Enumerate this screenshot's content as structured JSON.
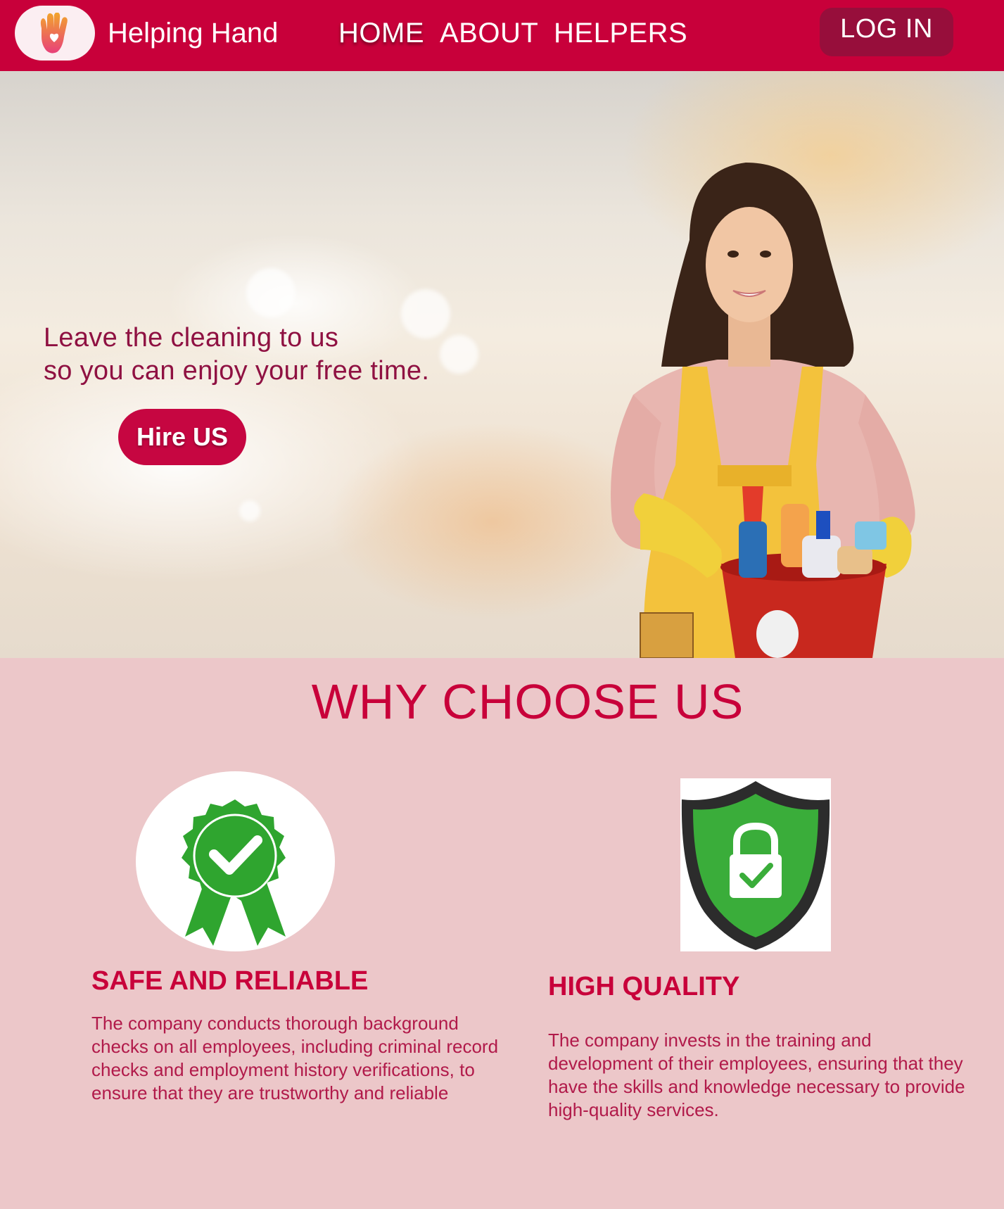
{
  "nav": {
    "brand": "Helping Hand",
    "links": [
      "HOME",
      "ABOUT",
      "HELPERS"
    ],
    "login": "LOG IN",
    "logo_icon": "hand-heart-icon"
  },
  "hero": {
    "line1": "Leave the cleaning to us",
    "line2": "so you can enjoy your free time.",
    "cta": "Hire US"
  },
  "why": {
    "title": "WHY CHOOSE US",
    "cards": [
      {
        "icon": "award-ribbon-icon",
        "title": "SAFE AND RELIABLE",
        "desc": "The company conducts thorough background checks on all employees, including criminal record checks and employment history verifications, to ensure that they are trustworthy and reliable"
      },
      {
        "icon": "shield-lock-icon",
        "title": "HIGH QUALITY",
        "desc": "The company invests in the training and development of their employees, ensuring that they have the skills and knowledge necessary to provide high-quality services."
      }
    ]
  },
  "colors": {
    "brand": "#c8003a",
    "login_bg": "#970e3b",
    "section_bg": "#ecc7c9",
    "icon_green": "#2fa52f"
  }
}
